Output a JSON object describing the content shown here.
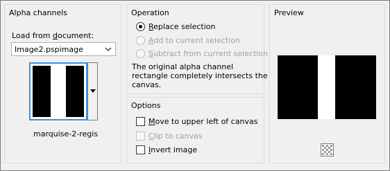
{
  "alpha": {
    "title": "Alpha channels",
    "load_label": "Load from document:",
    "load_label_accel": "d",
    "document_value": "Image2.pspimage",
    "channel_name": "marquise-2-regis"
  },
  "operation": {
    "title": "Operation",
    "options": [
      {
        "label": "Replace selection",
        "accel": "R",
        "selected": true,
        "enabled": true
      },
      {
        "label": "Add to current selection",
        "accel": "A",
        "selected": false,
        "enabled": false
      },
      {
        "label": "Subtract from current selection",
        "accel": "S",
        "selected": false,
        "enabled": false
      }
    ],
    "message": [
      "The original alpha channel",
      "rectangle completely intersects the",
      "canvas."
    ]
  },
  "options": {
    "title": "Options",
    "move": {
      "label": "Move to upper left of canvas",
      "accel": "M",
      "checked": false,
      "enabled": true
    },
    "clip": {
      "label": "Clip to canvas",
      "accel": "C",
      "checked": false,
      "enabled": false
    },
    "invert": {
      "label": "Invert image",
      "accel": "I",
      "checked": false,
      "enabled": true
    }
  },
  "preview": {
    "title": "Preview"
  },
  "colors": {
    "selection_border": "#3d8fe0",
    "disabled_text": "#a0a0a0"
  }
}
